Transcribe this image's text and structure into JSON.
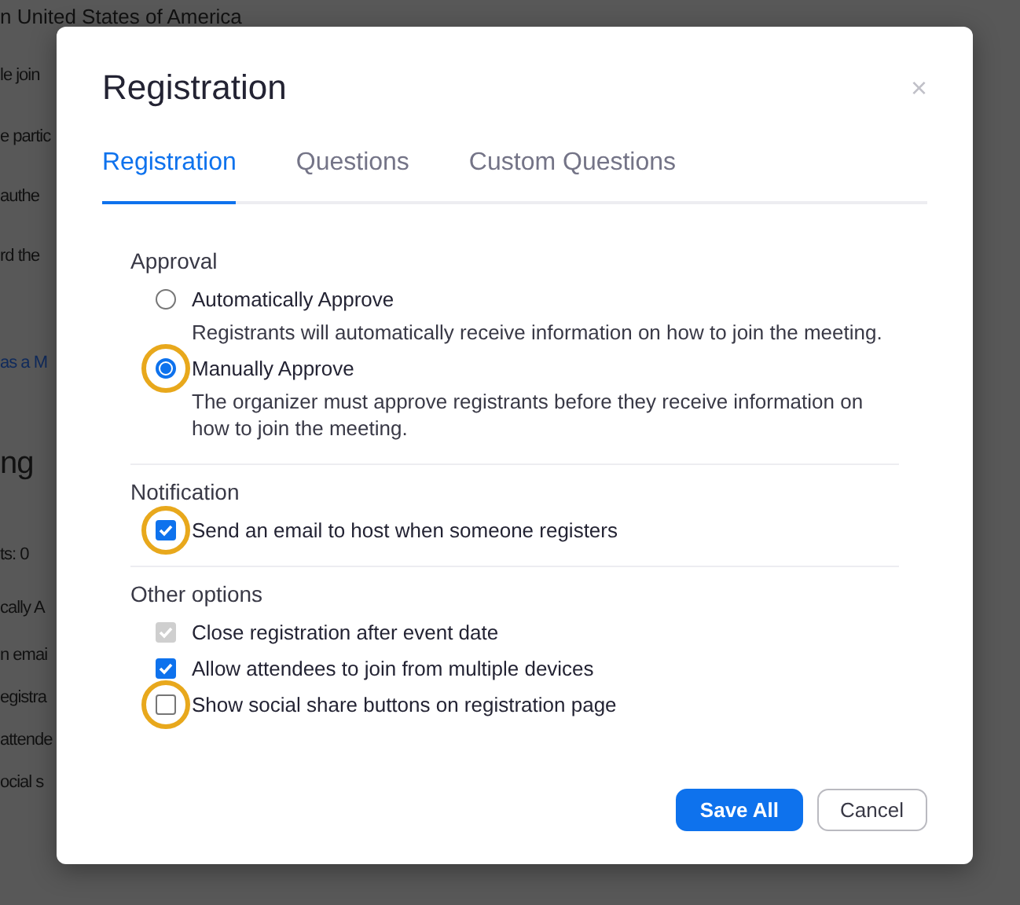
{
  "background_page": {
    "lines": [
      {
        "text": "n United States of America",
        "kind": "text"
      },
      {
        "text": "le join",
        "kind": "text"
      },
      {
        "text": "e partic",
        "kind": "text"
      },
      {
        "text": "authe",
        "kind": "text"
      },
      {
        "text": "rd the",
        "kind": "text"
      },
      {
        "text": "as a M",
        "kind": "link"
      },
      {
        "text": "ng",
        "kind": "heading"
      },
      {
        "text": "ts: 0",
        "kind": "text"
      },
      {
        "text": "cally A",
        "kind": "text"
      },
      {
        "text": "n emai",
        "kind": "text"
      },
      {
        "text": "egistra",
        "kind": "text"
      },
      {
        "text": "attende",
        "kind": "text"
      },
      {
        "text": "ocial s",
        "kind": "text"
      }
    ]
  },
  "dialog": {
    "title": "Registration",
    "close": "×",
    "tabs": [
      {
        "label": "Registration",
        "selected": true
      },
      {
        "label": "Questions",
        "selected": false
      },
      {
        "label": "Custom Questions",
        "selected": false
      }
    ],
    "sections": [
      {
        "heading": "Approval",
        "options": [
          {
            "kind": "radio",
            "label": "Automatically Approve",
            "description": "Registrants will automatically receive information on how to join the meeting.",
            "selected": false,
            "highlighted": false
          },
          {
            "kind": "radio",
            "label": "Manually Approve",
            "description": "The organizer must approve registrants before they receive information on how to join the meeting.",
            "selected": true,
            "highlighted": true
          }
        ]
      },
      {
        "heading": "Notification",
        "options": [
          {
            "kind": "checkbox",
            "label": "Send an email to host when someone registers",
            "checked": true,
            "disabled": false,
            "highlighted": true
          }
        ]
      },
      {
        "heading": "Other options",
        "options": [
          {
            "kind": "checkbox",
            "label": "Close registration after event date",
            "checked": true,
            "disabled": true,
            "highlighted": false
          },
          {
            "kind": "checkbox",
            "label": "Allow attendees to join from multiple devices",
            "checked": true,
            "disabled": false,
            "highlighted": false
          },
          {
            "kind": "checkbox",
            "label": "Show social share buttons on registration page",
            "checked": false,
            "disabled": false,
            "highlighted": true
          }
        ]
      }
    ],
    "buttons": [
      {
        "label": "Save All",
        "kind": "primary"
      },
      {
        "label": "Cancel",
        "kind": "secondary"
      }
    ]
  }
}
